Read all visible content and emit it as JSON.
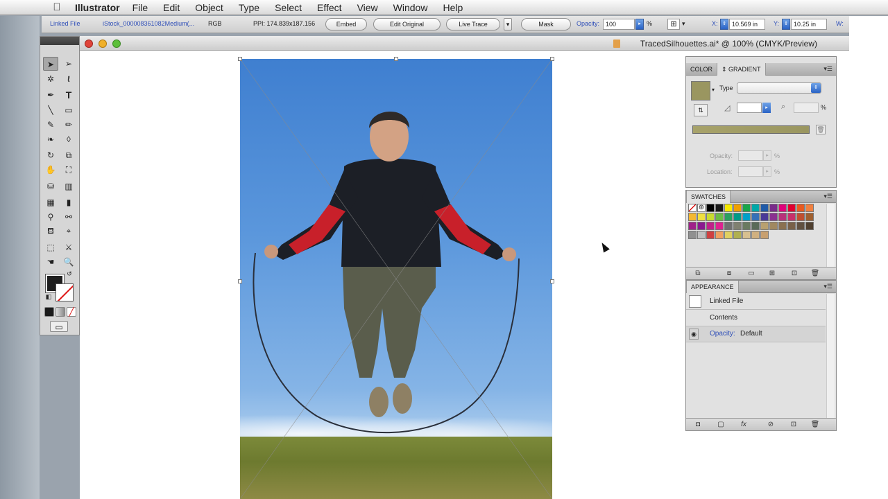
{
  "menubar": {
    "app_name": "Illustrator",
    "items": [
      "File",
      "Edit",
      "Object",
      "Type",
      "Select",
      "Effect",
      "View",
      "Window",
      "Help"
    ]
  },
  "controlbar": {
    "linked_file": "Linked File",
    "filename": "iStock_000008361082Medium(...",
    "color_mode": "RGB",
    "ppi": "PPI: 174.839x187.156",
    "embed": "Embed",
    "edit_original": "Edit Original",
    "live_trace": "Live Trace",
    "mask": "Mask",
    "opacity_label": "Opacity:",
    "opacity_value": "100",
    "percent": "%",
    "x_label": "X:",
    "x_value": "10.569 in",
    "y_label": "Y:",
    "y_value": "10.25 in",
    "w_label": "W:"
  },
  "document": {
    "title": "TracedSilhouettes.ai* @ 100% (CMYK/Preview)"
  },
  "color_panel": {
    "tab_color": "COLOR",
    "tab_gradient": "GRADIENT",
    "type_label": "Type",
    "percent": "%",
    "opacity_label": "Opacity:",
    "location_label": "Location:",
    "swatch_color": "#9a9660"
  },
  "swatches_panel": {
    "title": "SWATCHES",
    "rows": [
      [
        "#ffffff",
        "#ffffff",
        "#000000",
        "#1a1a1a",
        "#f6e900",
        "#f0a000",
        "#1aa64a",
        "#00a8a8",
        "#1f5aa8",
        "#7a2a8a",
        "#e0007a",
        "#e00030",
        "#e85a20",
        "#f08040"
      ],
      [
        "#f4b830",
        "#f0e040",
        "#c8dc30",
        "#6cbd45",
        "#2aa060",
        "#009a88",
        "#00a0c8",
        "#3670b8",
        "#4a3a98",
        "#8a3090",
        "#b8307a",
        "#c8306a",
        "#c05030",
        "#a06030"
      ],
      [
        "#a0208a",
        "#8a1890",
        "#c0208a",
        "#e02090",
        "#707070",
        "#808070",
        "#6a7a60",
        "#5a6a58",
        "#b8a070",
        "#a08860",
        "#8a7050",
        "#786048",
        "#605040",
        "#504030"
      ],
      [
        "#909090",
        "#c0c0c0",
        "#d04040",
        "#f0a060",
        "#e0d060",
        "#b0b050",
        "#d8c090",
        "#d0b080",
        "#c8a070"
      ]
    ]
  },
  "appearance_panel": {
    "title": "APPEARANCE",
    "linked_file": "Linked File",
    "contents": "Contents",
    "opacity_label": "Opacity:",
    "opacity_value": "Default"
  }
}
